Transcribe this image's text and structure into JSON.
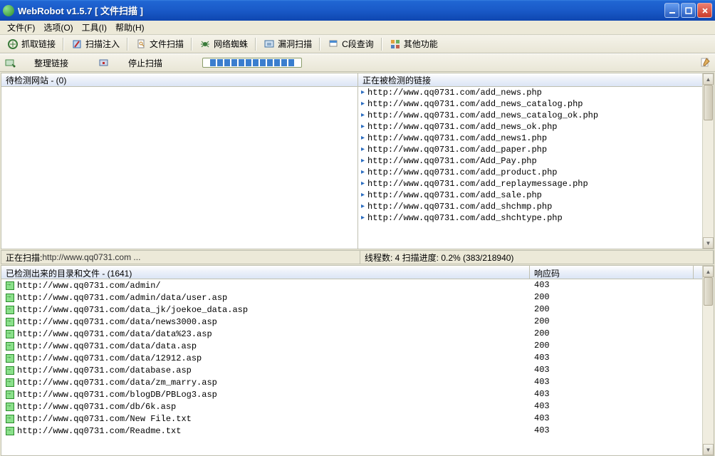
{
  "window": {
    "title": "WebRobot v1.5.7  [ 文件扫描 ]"
  },
  "menu": {
    "file": "文件(F)",
    "options": "选项(O)",
    "tools": "工具(I)",
    "help": "帮助(H)"
  },
  "toolbar": {
    "grab_links": "抓取链接",
    "scan_inject": "扫描注入",
    "file_scan": "文件扫描",
    "spider": "网络蜘蛛",
    "vuln_scan": "漏洞扫描",
    "c_query": "C段查询",
    "other": "其他功能"
  },
  "toolbar2": {
    "organize": "整理链接",
    "stop": "停止扫描"
  },
  "panes": {
    "left_header": "待检测网站 - (0)",
    "right_header": "正在被检测的链接",
    "links": [
      "http://www.qq0731.com/add_news.php",
      "http://www.qq0731.com/add_news_catalog.php",
      "http://www.qq0731.com/add_news_catalog_ok.php",
      "http://www.qq0731.com/add_news_ok.php",
      "http://www.qq0731.com/add_news1.php",
      "http://www.qq0731.com/add_paper.php",
      "http://www.qq0731.com/Add_Pay.php",
      "http://www.qq0731.com/add_product.php",
      "http://www.qq0731.com/add_replaymessage.php",
      "http://www.qq0731.com/add_sale.php",
      "http://www.qq0731.com/add_shchmp.php",
      "http://www.qq0731.com/add_shchtype.php"
    ]
  },
  "status": {
    "left_label": "正在扫描:",
    "left_url": "http://www.qq0731.com ...",
    "right": "线程数: 4  扫描进度: 0.2%   (383/218940)"
  },
  "grid": {
    "header_label": "已检测出来的目录和文件 - (1641)",
    "col2_label": "响应码",
    "rows": [
      {
        "url": "http://www.qq0731.com/admin/",
        "code": "403"
      },
      {
        "url": "http://www.qq0731.com/admin/data/user.asp",
        "code": "200"
      },
      {
        "url": "http://www.qq0731.com/data_jk/joekoe_data.asp",
        "code": "200"
      },
      {
        "url": "http://www.qq0731.com/data/news3000.asp",
        "code": "200"
      },
      {
        "url": "http://www.qq0731.com/data/data%23.asp",
        "code": "200"
      },
      {
        "url": "http://www.qq0731.com/data/data.asp",
        "code": "200"
      },
      {
        "url": "http://www.qq0731.com/data/12912.asp",
        "code": "403"
      },
      {
        "url": "http://www.qq0731.com/database.asp",
        "code": "403"
      },
      {
        "url": "http://www.qq0731.com/data/zm_marry.asp",
        "code": "403"
      },
      {
        "url": "http://www.qq0731.com/blogDB/PBLog3.asp",
        "code": "403"
      },
      {
        "url": "http://www.qq0731.com/db/6k.asp",
        "code": "403"
      },
      {
        "url": "http://www.qq0731.com/New File.txt",
        "code": "403"
      },
      {
        "url": "http://www.qq0731.com/Readme.txt",
        "code": "403"
      }
    ]
  }
}
